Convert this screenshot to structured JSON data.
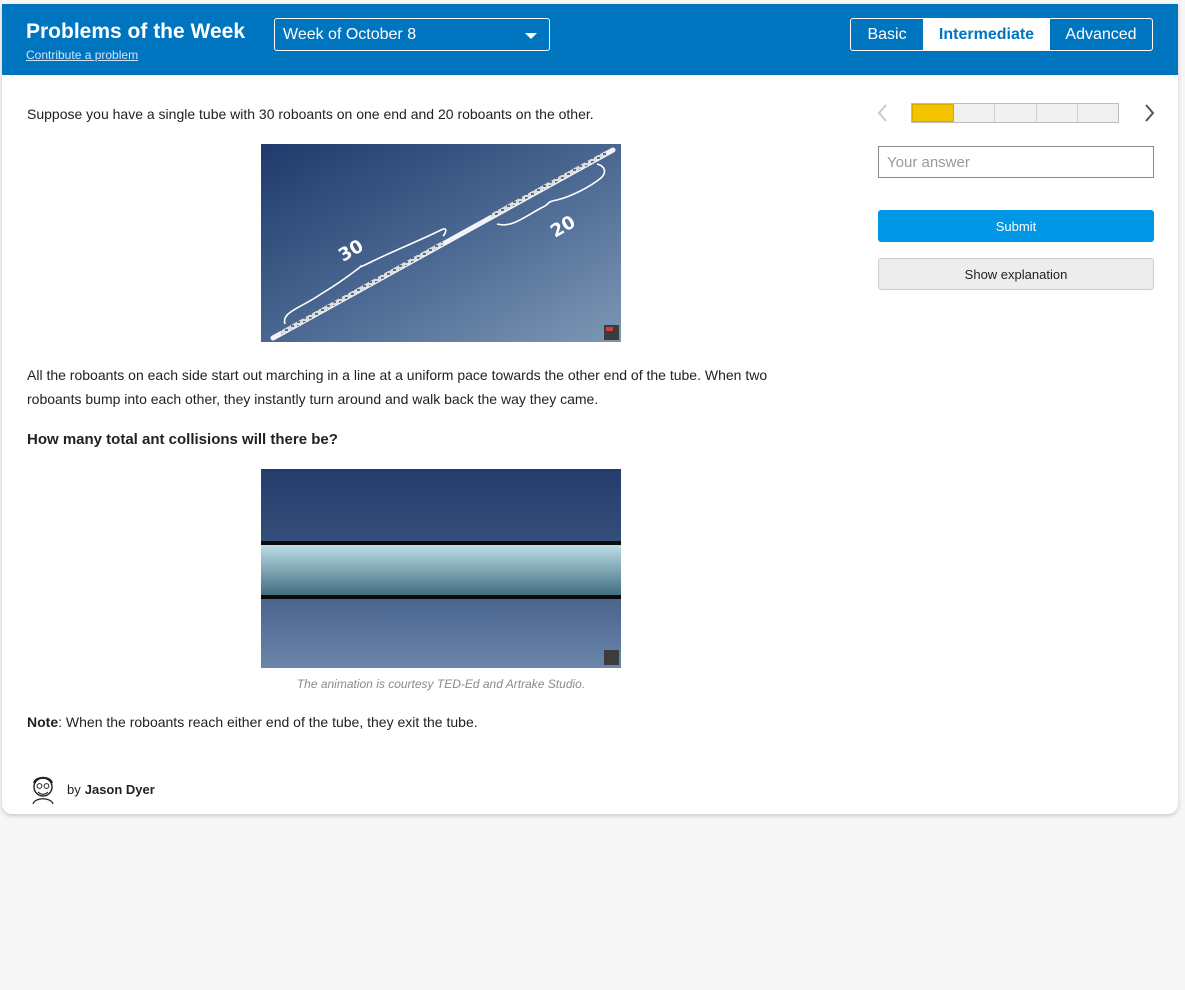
{
  "header": {
    "title": "Problems of the Week",
    "contribute_link": "Contribute a problem",
    "week_select": "Week of October 8",
    "levels": [
      "Basic",
      "Intermediate",
      "Advanced"
    ],
    "active_level": "Intermediate"
  },
  "problem": {
    "intro": "Suppose you have a single tube with 30 roboants on one end and 20 roboants on the other.",
    "figure1_labels": [
      "30",
      "20"
    ],
    "paragraph": "All the roboants on each side start out marching in a line at a uniform pace towards the other end of the tube. When two roboants bump into each other, they instantly turn around and walk back the way they came.",
    "question": "How many total ant collisions will there be?",
    "caption": "The animation is courtesy TED-Ed and Artrake Studio.",
    "note_label": "Note",
    "note_text": ": When the roboants reach either end of the tube, they exit the tube."
  },
  "author": {
    "by": "by",
    "name": "Jason Dyer"
  },
  "sidebar": {
    "progress_segments": 5,
    "progress_current": 1,
    "answer_placeholder": "Your answer",
    "submit_label": "Submit",
    "explain_label": "Show explanation"
  },
  "colors": {
    "header": "#0075bf",
    "submit": "#0097e6",
    "progress_active": "#f5c400"
  }
}
